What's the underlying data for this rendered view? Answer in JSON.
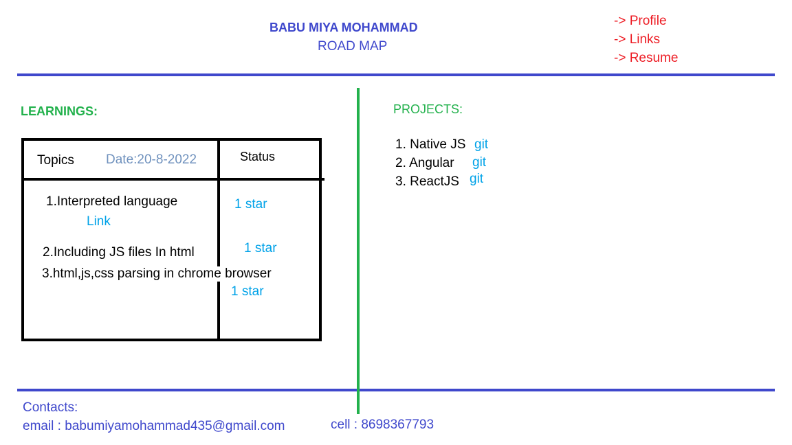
{
  "header": {
    "name": "BABU MIYA MOHAMMAD",
    "subtitle": "ROAD MAP"
  },
  "nav": [
    {
      "label": "-> Profile"
    },
    {
      "label": "-> Links"
    },
    {
      "label": "-> Resume"
    }
  ],
  "learnings": {
    "heading": "LEARNINGS:",
    "table": {
      "col_topics": "Topics",
      "date": "Date:20-8-2022",
      "col_status": "Status",
      "rows": [
        {
          "topic": "1.Interpreted language",
          "link": "Link",
          "status": "1 star"
        },
        {
          "topic": "2.Including JS files In html",
          "status": "1 star"
        },
        {
          "topic": "3.html,js,css parsing in chrome browser",
          "status": "1 star"
        }
      ]
    }
  },
  "projects": {
    "heading": "PROJECTS:",
    "items": [
      {
        "label": "1. Native JS",
        "link": "git"
      },
      {
        "label": "2. Angular",
        "link": "git"
      },
      {
        "label": "3. ReactJS",
        "link": "git"
      }
    ]
  },
  "contacts": {
    "heading": "Contacts:",
    "email": "email : babumiyamohammad435@gmail.com",
    "cell": "cell : 8698367793"
  },
  "colors": {
    "blue": "#3f48cc",
    "red": "#ed1c24",
    "green": "#22b14c",
    "link": "#00a2e8"
  }
}
